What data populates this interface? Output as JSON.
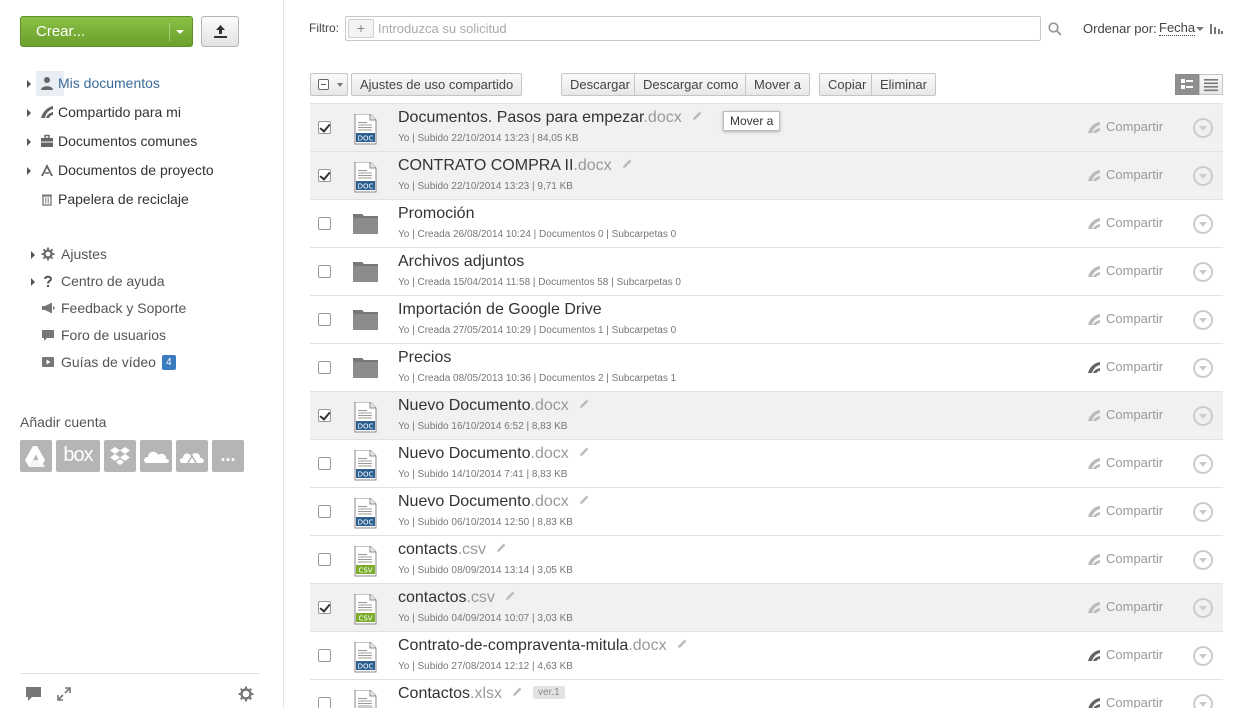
{
  "sidebar": {
    "create_label": "Crear...",
    "nav": [
      {
        "label": "Mis documentos",
        "icon": "user-icon",
        "expandable": true,
        "active": true
      },
      {
        "label": "Compartido para mi",
        "icon": "share-icon",
        "expandable": true
      },
      {
        "label": "Documentos comunes",
        "icon": "briefcase-icon",
        "expandable": true
      },
      {
        "label": "Documentos de proyecto",
        "icon": "project-icon",
        "expandable": true
      },
      {
        "label": "Papelera de reciclaje",
        "icon": "trash-icon",
        "expandable": false
      }
    ],
    "nav2": [
      {
        "label": "Ajustes",
        "icon": "gear-icon",
        "expandable": true
      },
      {
        "label": "Centro de ayuda",
        "icon": "question-icon",
        "expandable": true
      },
      {
        "label": "Feedback y Soporte",
        "icon": "megaphone-icon",
        "expandable": false
      },
      {
        "label": "Foro de usuarios",
        "icon": "speech-bubble-icon",
        "expandable": false
      },
      {
        "label": "Guías de vídeo",
        "icon": "video-icon",
        "expandable": false,
        "badge": "4"
      }
    ],
    "add_account_label": "Añadir cuenta",
    "accounts": [
      {
        "name": "google-drive",
        "label": ""
      },
      {
        "name": "box",
        "label": "box"
      },
      {
        "name": "dropbox",
        "label": ""
      },
      {
        "name": "onedrive",
        "label": ""
      },
      {
        "name": "skydrive",
        "label": ""
      },
      {
        "name": "more",
        "label": "..."
      }
    ]
  },
  "header": {
    "filter_label": "Filtro:",
    "filter_placeholder": "Introduzca su solicitud",
    "sort_label": "Ordenar por:",
    "sort_value": "Fecha"
  },
  "toolbar": {
    "buttons": [
      "Ajustes de uso compartido",
      "Descargar",
      "Descargar como",
      "Mover a",
      "Copiar",
      "Eliminar"
    ]
  },
  "tooltip": "Mover a",
  "share_label": "Compartir",
  "files": [
    {
      "name": "Documentos. Pasos para empezar",
      "ext": ".docx",
      "type": "docx",
      "meta": "Yo | Subido 22/10/2014 13:23 | 84,05 KB",
      "checked": true,
      "editable": true,
      "shared": false
    },
    {
      "name": "CONTRATO COMPRA II",
      "ext": ".docx",
      "type": "docx",
      "meta": "Yo | Subido 22/10/2014 13:23 | 9,71 KB",
      "checked": true,
      "editable": true,
      "shared": false
    },
    {
      "name": "Promoción",
      "ext": "",
      "type": "folder",
      "meta": "Yo | Creada 26/08/2014 10:24 | Documentos  0 | Subcarpetas 0",
      "checked": false,
      "editable": false,
      "shared": false
    },
    {
      "name": "Archivos adjuntos",
      "ext": "",
      "type": "folder",
      "meta": "Yo | Creada 15/04/2014 11:58 | Documentos  58 | Subcarpetas 0",
      "checked": false,
      "editable": false,
      "shared": false
    },
    {
      "name": "Importación de Google Drive",
      "ext": "",
      "type": "folder",
      "meta": "Yo | Creada 27/05/2014 10:29 | Documentos  1 | Subcarpetas 0",
      "checked": false,
      "editable": false,
      "shared": false
    },
    {
      "name": "Precios",
      "ext": "",
      "type": "folder",
      "meta": "Yo | Creada 08/05/2013 10:36 | Documentos  2 | Subcarpetas 1",
      "checked": false,
      "editable": false,
      "shared": true
    },
    {
      "name": "Nuevo Documento",
      "ext": ".docx",
      "type": "docx",
      "meta": "Yo | Subido 16/10/2014 6:52 | 8,83 KB",
      "checked": true,
      "editable": true,
      "shared": false
    },
    {
      "name": "Nuevo Documento",
      "ext": ".docx",
      "type": "docx",
      "meta": "Yo | Subido 14/10/2014 7:41 | 8,83 KB",
      "checked": false,
      "editable": true,
      "shared": false
    },
    {
      "name": "Nuevo Documento",
      "ext": ".docx",
      "type": "docx",
      "meta": "Yo | Subido 06/10/2014 12:50 | 8,83 KB",
      "checked": false,
      "editable": true,
      "shared": false
    },
    {
      "name": "contacts",
      "ext": ".csv",
      "type": "csv",
      "meta": "Yo | Subido 08/09/2014 13:14 | 3,05 KB",
      "checked": false,
      "editable": true,
      "shared": false
    },
    {
      "name": "contactos",
      "ext": ".csv",
      "type": "csv",
      "meta": "Yo | Subido 04/09/2014 10:07 | 3,03 KB",
      "checked": true,
      "editable": true,
      "shared": false
    },
    {
      "name": "Contrato-de-compraventa-mitula",
      "ext": ".docx",
      "type": "docx",
      "meta": "Yo | Subido 27/08/2014 12:12 | 4,63 KB",
      "checked": false,
      "editable": true,
      "shared": true
    },
    {
      "name": "Contactos",
      "ext": ".xlsx",
      "type": "xlsx",
      "meta": "",
      "checked": false,
      "editable": true,
      "shared": true,
      "version": "ver.1"
    }
  ],
  "colors": {
    "create_green": "#7ab33a",
    "accent_blue": "#3b6a9a",
    "badge_blue": "#3b7bbf",
    "selected_row": "#f1f1f1"
  }
}
